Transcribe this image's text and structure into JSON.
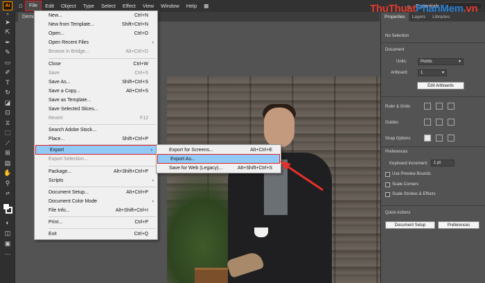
{
  "menubar": {
    "logo": "Ai",
    "items": [
      "File",
      "Edit",
      "Object",
      "Type",
      "Select",
      "Effect",
      "View",
      "Window",
      "Help"
    ],
    "workspace": "Essentials"
  },
  "watermark": {
    "part1": "ThuThuat",
    "part2": "PhanMem",
    "part3": ".vn"
  },
  "document_tab": "Demo",
  "file_menu": [
    {
      "label": "New...",
      "shortcut": "Ctrl+N"
    },
    {
      "label": "New from Template...",
      "shortcut": "Shift+Ctrl+N"
    },
    {
      "label": "Open...",
      "shortcut": "Ctrl+O"
    },
    {
      "label": "Open Recent Files",
      "shortcut": ""
    },
    {
      "label": "Browse in Bridge...",
      "shortcut": "Alt+Ctrl+O"
    },
    {
      "label": "Close",
      "shortcut": "Ctrl+W"
    },
    {
      "label": "Save",
      "shortcut": "Ctrl+S"
    },
    {
      "label": "Save As...",
      "shortcut": "Shift+Ctrl+S"
    },
    {
      "label": "Save a Copy...",
      "shortcut": "Alt+Ctrl+S"
    },
    {
      "label": "Save as Template...",
      "shortcut": ""
    },
    {
      "label": "Save Selected Slices...",
      "shortcut": ""
    },
    {
      "label": "Revert",
      "shortcut": "F12"
    },
    {
      "label": "Search Adobe Stock...",
      "shortcut": ""
    },
    {
      "label": "Place...",
      "shortcut": "Shift+Ctrl+P"
    },
    {
      "label": "Export",
      "shortcut": ""
    },
    {
      "label": "Export Selection...",
      "shortcut": ""
    },
    {
      "label": "Package...",
      "shortcut": "Alt+Shift+Ctrl+P"
    },
    {
      "label": "Scripts",
      "shortcut": ""
    },
    {
      "label": "Document Setup...",
      "shortcut": "Alt+Ctrl+P"
    },
    {
      "label": "Document Color Mode",
      "shortcut": ""
    },
    {
      "label": "File Info...",
      "shortcut": "Alt+Shift+Ctrl+I"
    },
    {
      "label": "Print...",
      "shortcut": "Ctrl+P"
    },
    {
      "label": "Exit",
      "shortcut": "Ctrl+Q"
    }
  ],
  "export_submenu": [
    {
      "label": "Export for Screens...",
      "shortcut": "Alt+Ctrl+E"
    },
    {
      "label": "Export As...",
      "shortcut": ""
    },
    {
      "label": "Save for Web (Legacy)...",
      "shortcut": "Alt+Shift+Ctrl+S"
    }
  ],
  "panel": {
    "tabs": [
      "Properties",
      "Layers",
      "Libraries"
    ],
    "no_selection": "No Selection",
    "document_label": "Document",
    "units_label": "Units:",
    "units_value": "Points",
    "artboard_label": "Artboard:",
    "artboard_value": "1",
    "edit_artboards": "Edit Artboards",
    "rulers_grids": "Ruler & Grids",
    "guides": "Guides",
    "snap_options": "Snap Options",
    "preferences_label": "Preferences",
    "keyboard_increment_label": "Keyboard Increment:",
    "keyboard_increment_value": "1 pt",
    "use_preview_bounds": "Use Preview Bounds",
    "scale_corners": "Scale Corners",
    "scale_strokes": "Scale Strokes & Effects",
    "quick_actions": "Quick Actions",
    "document_setup_btn": "Document Setup",
    "preferences_btn": "Preferences"
  }
}
